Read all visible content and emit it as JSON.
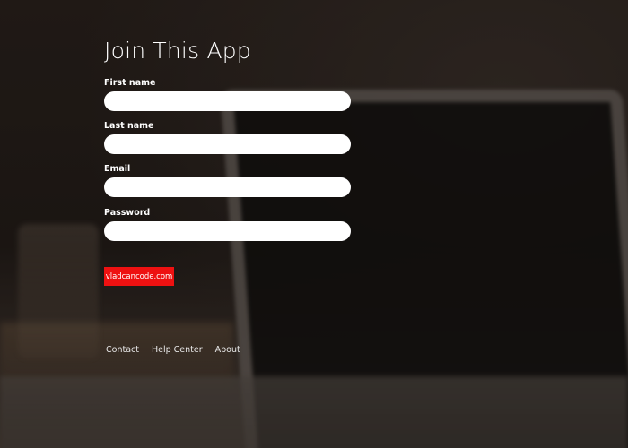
{
  "page": {
    "title": "Join This App"
  },
  "form": {
    "fields": [
      {
        "label": "First name",
        "value": "",
        "placeholder": ""
      },
      {
        "label": "Last name",
        "value": "",
        "placeholder": ""
      },
      {
        "label": "Email",
        "value": "",
        "placeholder": ""
      },
      {
        "label": "Password",
        "value": "",
        "placeholder": ""
      }
    ],
    "button_label": "vladcancode.com"
  },
  "footer": {
    "links": [
      "Contact",
      "Help Center",
      "About"
    ]
  },
  "colors": {
    "accent": "#ee1111",
    "input_background": "#ffffff",
    "text": "#ffffff"
  }
}
